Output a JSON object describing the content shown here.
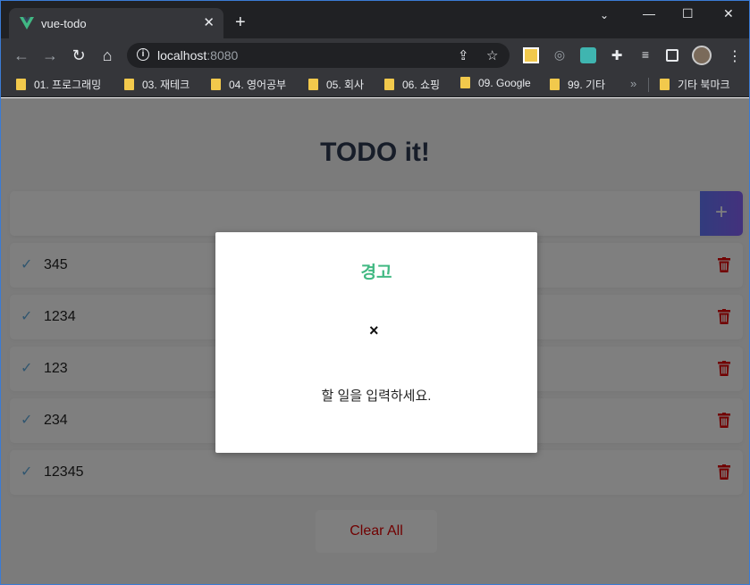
{
  "browser": {
    "tab_title": "vue-todo",
    "url_host": "localhost",
    "url_port": ":8080",
    "bookmarks": [
      {
        "label": "01. 프로그래밍"
      },
      {
        "label": "03. 재테크"
      },
      {
        "label": "04. 영어공부"
      },
      {
        "label": "05. 회사"
      },
      {
        "label": "06. 쇼핑"
      },
      {
        "label": "09. Google"
      },
      {
        "label": "99. 기타"
      },
      {
        "label": "기타 북마크"
      }
    ]
  },
  "app": {
    "title": "TODO it!",
    "input_value": "",
    "add_label": "+",
    "todos": [
      {
        "text": "345"
      },
      {
        "text": "1234"
      },
      {
        "text": "123"
      },
      {
        "text": "234"
      },
      {
        "text": "12345"
      }
    ],
    "clear_all": "Clear All"
  },
  "modal": {
    "title": "경고",
    "close": "×",
    "message": "할 일을 입력하세요."
  },
  "colors": {
    "accent": "#42b983",
    "add_gradient_start": "#6478fb",
    "add_gradient_end": "#8763fb",
    "check": "#62acde",
    "danger": "#e20303"
  }
}
